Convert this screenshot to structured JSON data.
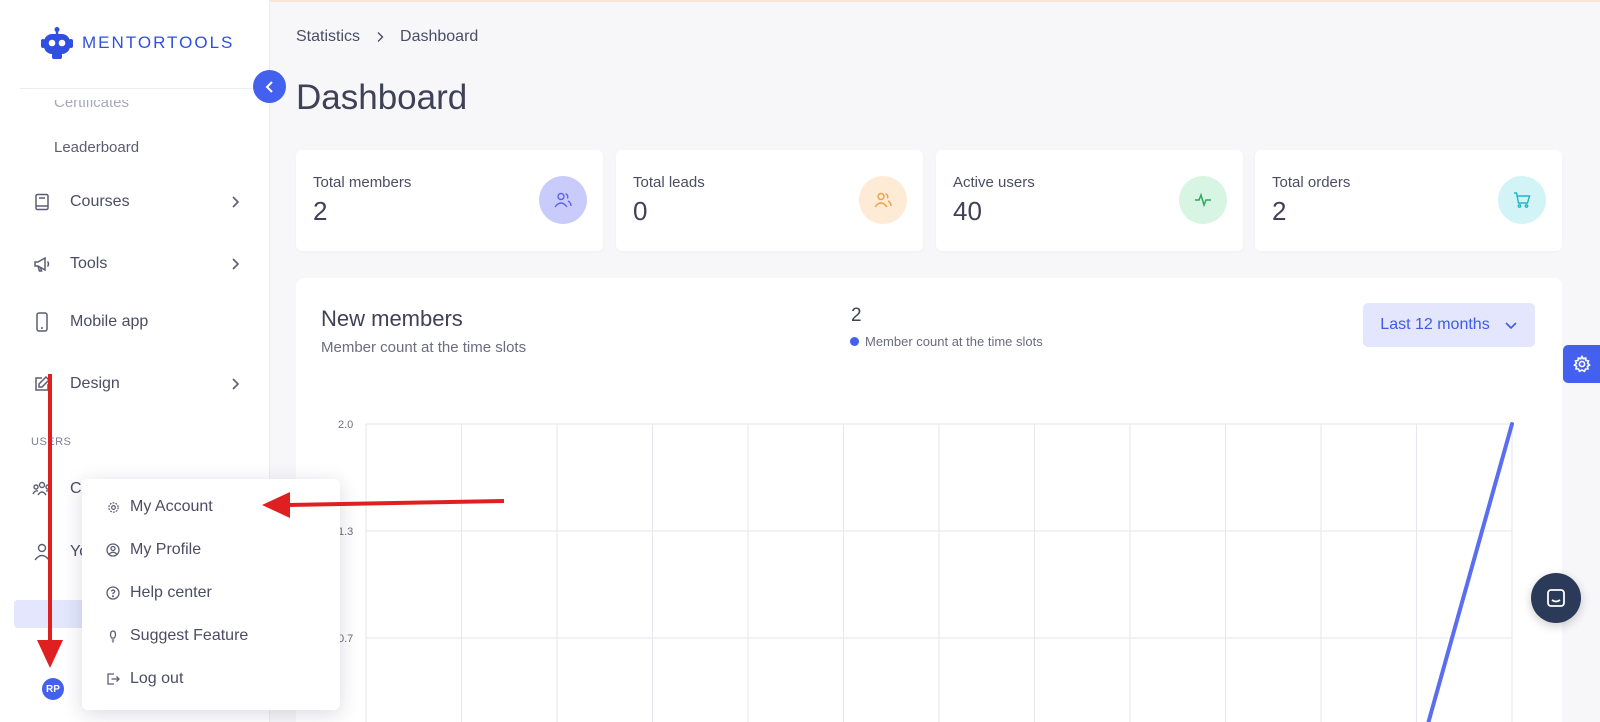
{
  "brand": {
    "name": "MENTORTOOLS",
    "color": "#2f4fe0"
  },
  "sidebar": {
    "sub_items": [
      "Certificates",
      "Leaderboard"
    ],
    "nav": [
      {
        "label": "Courses",
        "icon": "book-icon",
        "has_chevron": true
      },
      {
        "label": "Tools",
        "icon": "megaphone-icon",
        "has_chevron": true
      },
      {
        "label": "Mobile app",
        "icon": "phone-icon",
        "has_chevron": false
      },
      {
        "label": "Design",
        "icon": "pencil-square-icon",
        "has_chevron": true
      }
    ],
    "section_label": "USERS",
    "partial_items": [
      "C",
      "Yo"
    ],
    "avatar_initials": "RP"
  },
  "user_menu": {
    "items": [
      {
        "label": "My Account",
        "icon": "gear-icon"
      },
      {
        "label": "My Profile",
        "icon": "user-circle-icon"
      },
      {
        "label": "Help center",
        "icon": "question-circle-icon"
      },
      {
        "label": "Suggest Feature",
        "icon": "lightbulb-icon"
      },
      {
        "label": "Log out",
        "icon": "logout-icon"
      }
    ]
  },
  "breadcrumb": [
    "Statistics",
    "Dashboard"
  ],
  "page_title": "Dashboard",
  "stats": [
    {
      "label": "Total members",
      "value": "2",
      "icon": "users-icon",
      "color": "#6a72f0",
      "bg": "#c9ccfb"
    },
    {
      "label": "Total leads",
      "value": "0",
      "icon": "users-icon",
      "color": "#f0a040",
      "bg": "#fdebd6"
    },
    {
      "label": "Active users",
      "value": "40",
      "icon": "activity-icon",
      "color": "#2aa860",
      "bg": "#d8f4e2"
    },
    {
      "label": "Total orders",
      "value": "2",
      "icon": "cart-icon",
      "color": "#22b3c8",
      "bg": "#d3f4f7"
    }
  ],
  "new_members": {
    "title": "New members",
    "subtitle": "Member count at the time slots",
    "total": "2",
    "legend": "Member count at the time slots",
    "range": "Last 12 months"
  },
  "chart_data": {
    "type": "line",
    "title": "New members",
    "y_ticks": [
      "2.0",
      "1.3",
      "0.7"
    ],
    "ylim": [
      0,
      2.0
    ],
    "x_slots": 12,
    "series": [
      {
        "name": "Member count at the time slots",
        "values": [
          0,
          0,
          0,
          0,
          0,
          0,
          0,
          0,
          0,
          0,
          0,
          0,
          2
        ],
        "color": "#5b6ef0"
      }
    ],
    "grid": true
  },
  "colors": {
    "accent": "#4360ee",
    "annotation": "#e02020"
  }
}
